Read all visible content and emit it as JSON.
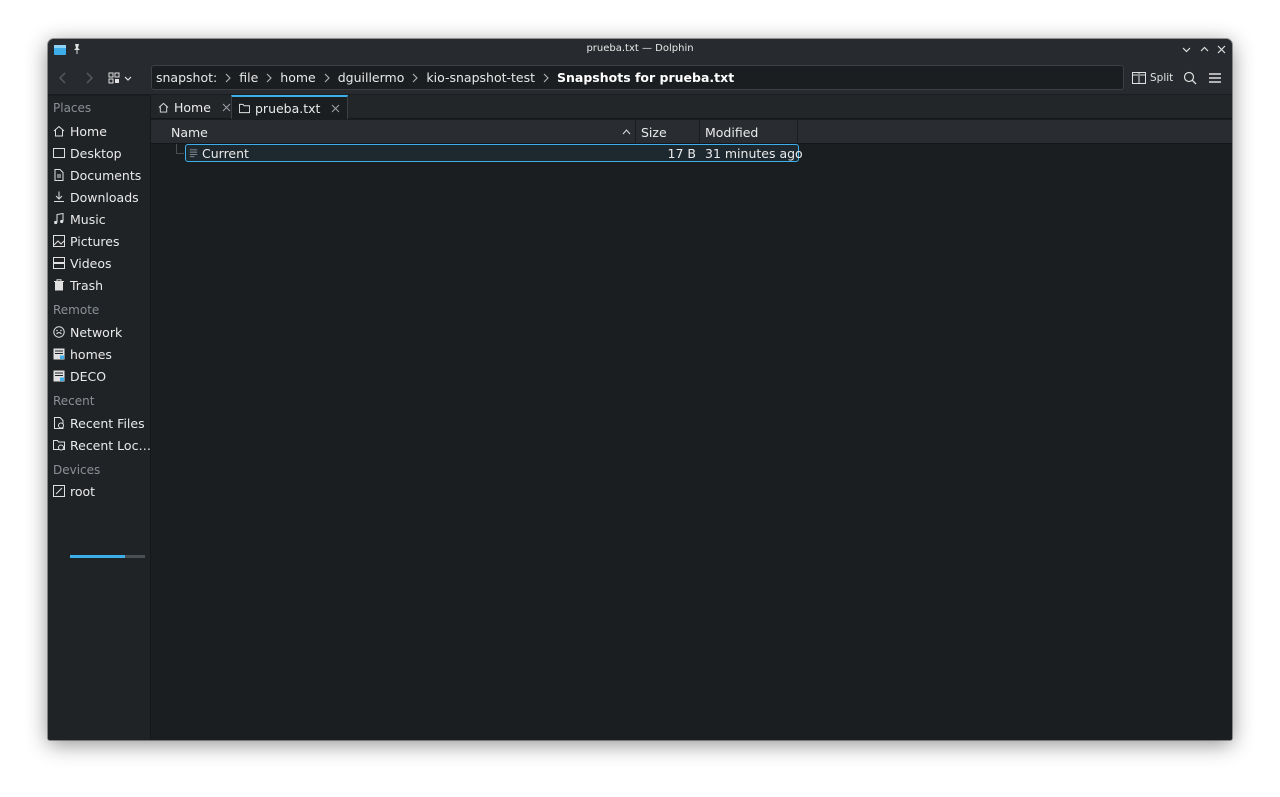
{
  "window": {
    "title": "prueba.txt — Dolphin"
  },
  "toolbar": {
    "breadcrumbs": [
      "snapshot:",
      "file",
      "home",
      "dguillermo",
      "kio-snapshot-test",
      "Snapshots for prueba.txt"
    ],
    "split_label": "Split"
  },
  "sidebar": {
    "sections": {
      "places": "Places",
      "remote": "Remote",
      "recent": "Recent",
      "devices": "Devices"
    },
    "places": [
      "Home",
      "Desktop",
      "Documents",
      "Downloads",
      "Music",
      "Pictures",
      "Videos",
      "Trash"
    ],
    "remote": [
      "Network",
      "homes",
      "DECO"
    ],
    "recent": [
      "Recent Files",
      "Recent Loc…"
    ],
    "devices": [
      {
        "label": "root",
        "usage_fraction": 0.73
      }
    ]
  },
  "tabs": [
    {
      "label": "Home",
      "active": false
    },
    {
      "label": "prueba.txt",
      "active": true
    }
  ],
  "columns": {
    "name": "Name",
    "size": "Size",
    "modified": "Modified"
  },
  "files": [
    {
      "name": "Current",
      "size": "17 B",
      "modified": "31 minutes ago"
    }
  ],
  "colors": {
    "accent": "#3daee9",
    "background": "#1b1e20",
    "panel": "#272a2e"
  }
}
